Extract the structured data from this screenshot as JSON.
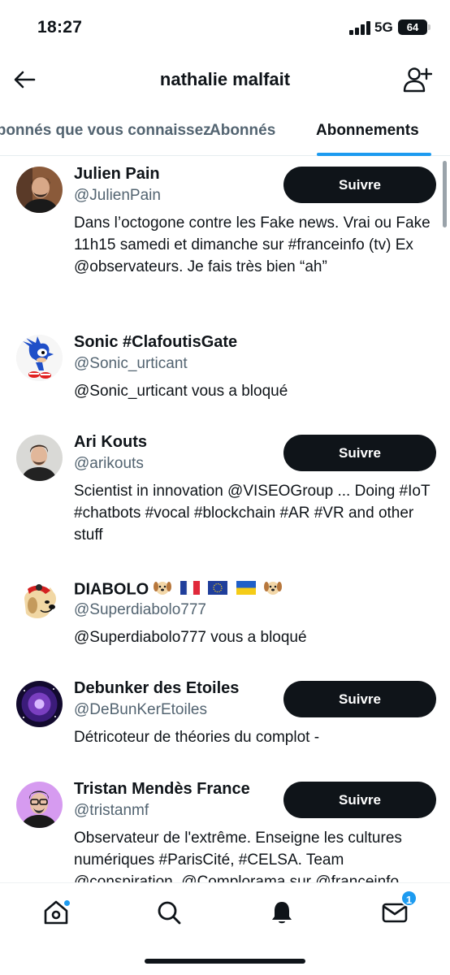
{
  "status_bar": {
    "time": "18:27",
    "network": "5G",
    "battery": "64"
  },
  "header": {
    "title": "nathalie malfait"
  },
  "tabs": [
    {
      "label": "Abonnés que vous connaissez"
    },
    {
      "label": "Abonnés"
    },
    {
      "label": "Abonnements",
      "active": true
    }
  ],
  "users": [
    {
      "name": "Julien Pain",
      "handle": "@JulienPain",
      "bio": "Dans l’octogone contre les Fake news. Vrai ou Fake 11h15 samedi et dimanche sur #franceinfo (tv) Ex @observateurs. Je fais très bien “ah”",
      "button": "Suivre"
    },
    {
      "name": "Sonic #ClafoutisGate",
      "handle": "@Sonic_urticant",
      "bio": "@Sonic_urticant vous a bloqué"
    },
    {
      "name": "Ari Kouts",
      "handle": "@arikouts",
      "bio": "Scientist in innovation @VISEOGroup ... Doing #IoT #chatbots #vocal #blockchain #AR #VR and other stuff",
      "button": "Suivre"
    },
    {
      "name": "DIABOLO",
      "name_emojis": [
        "dog-face",
        "flag-france",
        "flag-eu",
        "flag-ukraine",
        "dog-face"
      ],
      "handle": "@Superdiabolo777",
      "bio": "@Superdiabolo777 vous a bloqué"
    },
    {
      "name": "Debunker des Etoiles",
      "handle": "@DeBunKerEtoiles",
      "bio": "Détricoteur de théories du complot -",
      "button": "Suivre"
    },
    {
      "name": "Tristan Mendès France",
      "handle": "@tristanmf",
      "bio": "Observateur de l'extrême. Enseigne les cultures numériques #ParisCité, #CELSA. Team @conspiration, @Complorama sur @franceinfo",
      "button": "Suivre"
    }
  ],
  "bottom_nav": {
    "items": [
      "home-icon",
      "search-icon",
      "bell-icon",
      "mail-icon"
    ],
    "mail_badge": "1"
  },
  "colors": {
    "accent": "#1d9bf0",
    "text": "#0f1419",
    "secondary": "#536471"
  }
}
